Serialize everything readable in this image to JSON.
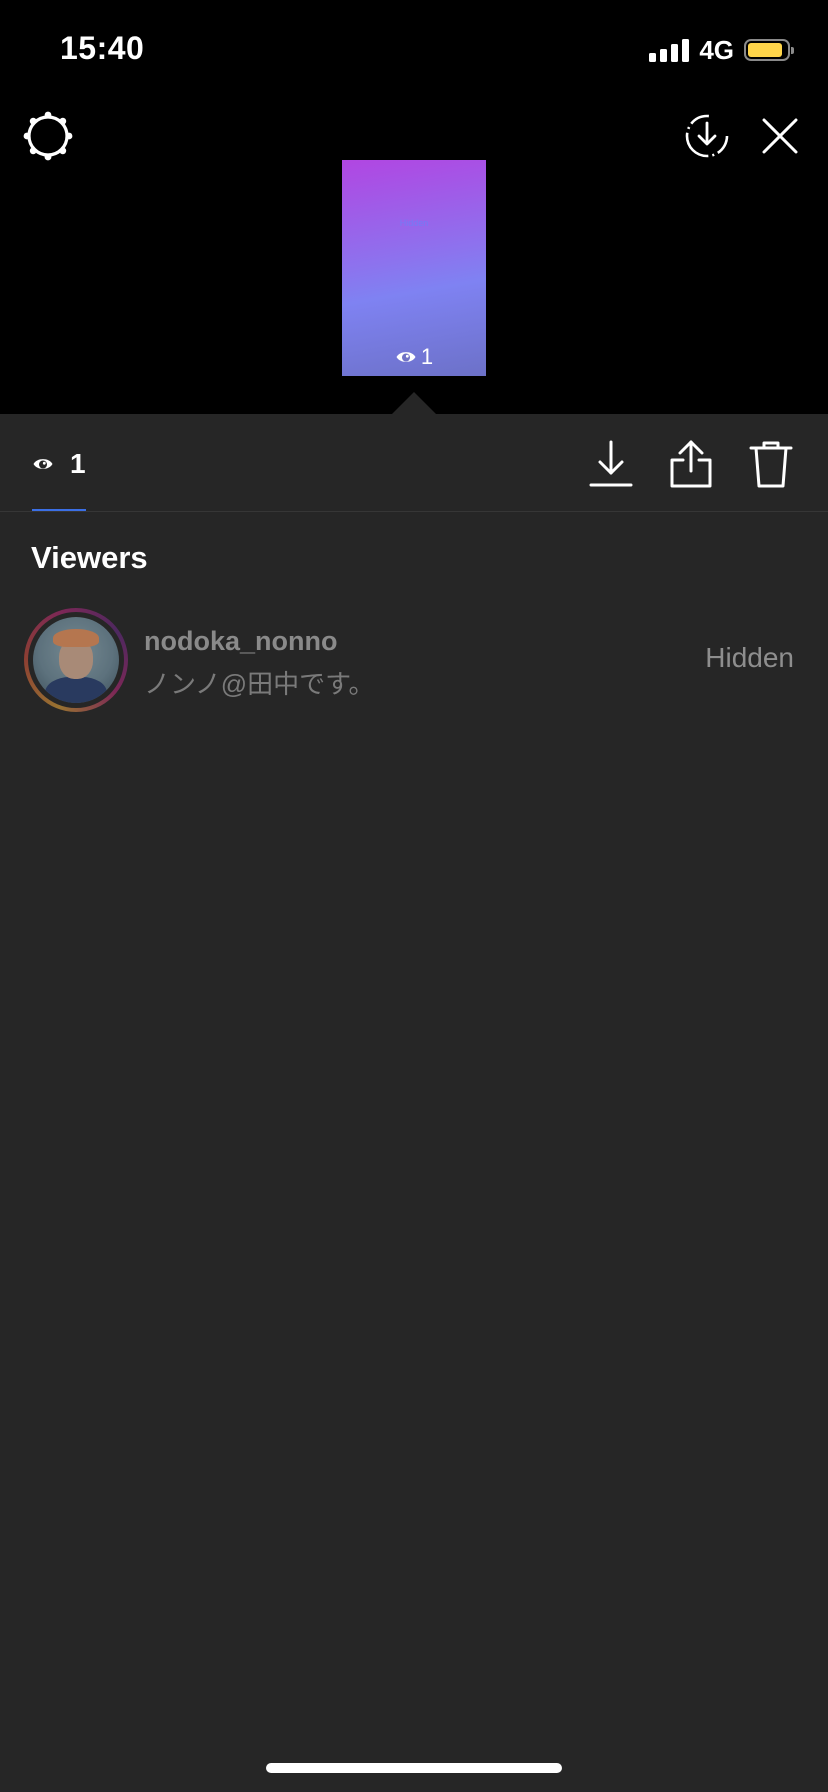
{
  "status_bar": {
    "time": "15:40",
    "network": "4G",
    "signal_bars": 4,
    "battery_level": 0.85,
    "battery_color": "#ffd54a"
  },
  "header": {
    "settings_icon": "settings-gear-icon",
    "save_icon": "save-download-dashed-icon",
    "close_icon": "close-icon"
  },
  "story_preview": {
    "gradient": [
      "#b146e2",
      "#7f82f2",
      "#6c71c8"
    ],
    "caption": "Hidden",
    "view_count": "1"
  },
  "toolbar": {
    "view_count": "1",
    "tab_accent": "#3b6fe5",
    "actions": [
      {
        "name": "download",
        "icon": "download-icon"
      },
      {
        "name": "share",
        "icon": "share-icon"
      },
      {
        "name": "delete",
        "icon": "trash-icon"
      }
    ]
  },
  "viewers": {
    "title": "Viewers",
    "items": [
      {
        "username": "nodoka_nonno",
        "full_name": "ノンノ@田中です。",
        "status": "Hidden"
      }
    ]
  }
}
